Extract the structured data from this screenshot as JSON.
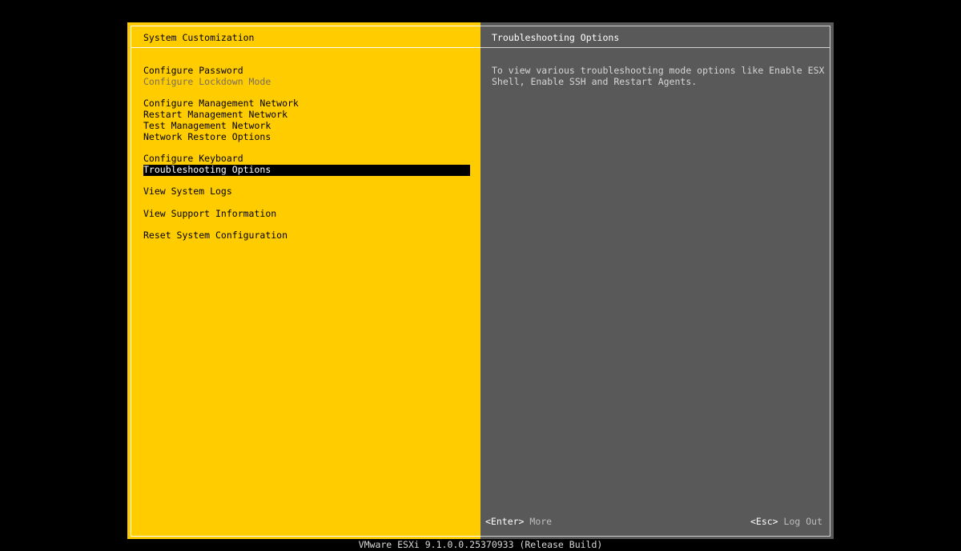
{
  "left_panel": {
    "title": "System Customization",
    "menu": [
      {
        "label": "Configure Password",
        "state": "normal"
      },
      {
        "label": "Configure Lockdown Mode",
        "state": "disabled"
      },
      {
        "label": "Configure Management Network",
        "state": "normal"
      },
      {
        "label": "Restart Management Network",
        "state": "normal"
      },
      {
        "label": "Test Management Network",
        "state": "normal"
      },
      {
        "label": "Network Restore Options",
        "state": "normal"
      },
      {
        "label": "Configure Keyboard",
        "state": "normal"
      },
      {
        "label": "Troubleshooting Options",
        "state": "selected"
      },
      {
        "label": "View System Logs",
        "state": "normal"
      },
      {
        "label": "View Support Information",
        "state": "normal"
      },
      {
        "label": "Reset System Configuration",
        "state": "normal"
      }
    ]
  },
  "right_panel": {
    "title": "Troubleshooting Options",
    "description_line1": "To view various troubleshooting mode options like Enable ESX",
    "description_line2": "Shell, Enable SSH and Restart Agents."
  },
  "footer": {
    "enter_key": "<Enter>",
    "enter_action": "More",
    "esc_key": "<Esc>",
    "esc_action": "Log Out"
  },
  "status_bar": {
    "text": "VMware ESXi 9.1.0.0.25370933 (Release Build)"
  },
  "colors": {
    "left_background": "#ffcc00",
    "right_background": "#595959",
    "selection_background": "#000000",
    "selection_text": "#ffffff"
  }
}
